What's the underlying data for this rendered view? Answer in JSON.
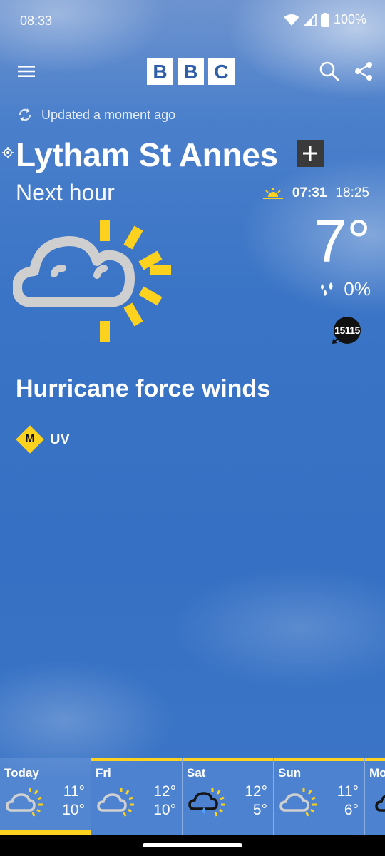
{
  "status_bar": {
    "time": "08:33",
    "battery": "100%"
  },
  "header": {
    "logo_letters": [
      "B",
      "B",
      "C"
    ]
  },
  "updated_text": "Updated a moment ago",
  "location": {
    "name": "Lytham St Annes"
  },
  "next_hour": {
    "label": "Next hour",
    "sunrise": "07:31",
    "sunset": "18:25",
    "temperature": "7°",
    "rain_chance": "0%",
    "wind_speed": "15115",
    "condition_icon": "cloud-sun-icon"
  },
  "summary": "Hurricane force winds",
  "uv": {
    "level": "M",
    "label": "UV"
  },
  "forecast": [
    {
      "day": "Today",
      "high": "11°",
      "low": "10°",
      "icon": "sunny-intervals-icon"
    },
    {
      "day": "Fri",
      "high": "12°",
      "low": "10°",
      "icon": "sunny-intervals-icon"
    },
    {
      "day": "Sat",
      "high": "12°",
      "low": "5°",
      "icon": "light-rain-sun-icon"
    },
    {
      "day": "Sun",
      "high": "11°",
      "low": "6°",
      "icon": "sunny-intervals-icon"
    },
    {
      "day": "Mo",
      "high": "",
      "low": "",
      "icon": "cloud-icon"
    }
  ],
  "colors": {
    "accent": "#fdd21e",
    "sky": "#3570c4"
  }
}
